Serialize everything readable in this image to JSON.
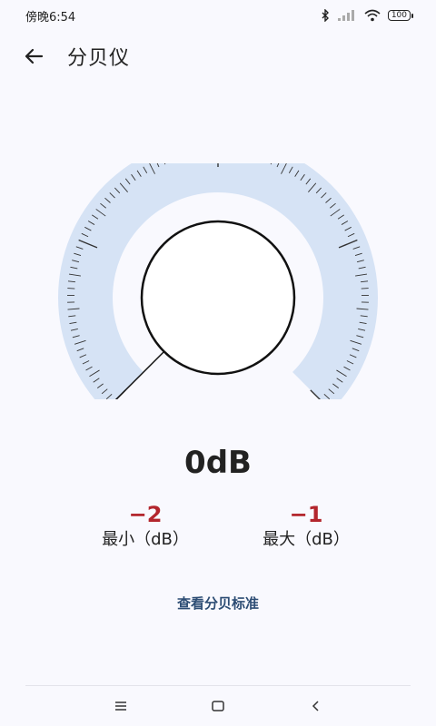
{
  "status": {
    "time": "傍晚6:54",
    "battery": "100",
    "icons": [
      "bluetooth-icon",
      "signal-icon",
      "wifi-icon",
      "battery-icon"
    ]
  },
  "header": {
    "title": "分贝仪",
    "back_icon": "arrow-left-icon"
  },
  "meter": {
    "reading": "0dB",
    "level_db": 0
  },
  "stats": {
    "min_value": "−2",
    "min_label": "最小（dB）",
    "max_value": "−1",
    "max_label": "最大（dB）"
  },
  "link": {
    "label": "查看分贝标准"
  },
  "colors": {
    "gauge_band": "#d6e3f5",
    "stat_value": "#b3262d",
    "link": "#2d4d74"
  },
  "nav": {
    "items": [
      "menu-icon",
      "home-icon",
      "back-icon"
    ]
  }
}
